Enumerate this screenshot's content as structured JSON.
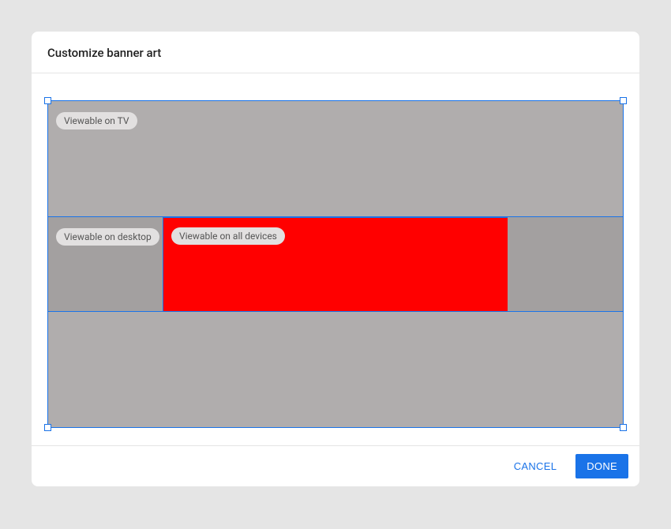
{
  "dialog": {
    "title": "Customize banner art"
  },
  "zones": {
    "tv_label": "Viewable on TV",
    "desktop_label": "Viewable on desktop",
    "safe_label": "Viewable on all devices"
  },
  "footer": {
    "cancel_label": "CANCEL",
    "done_label": "DONE"
  },
  "colors": {
    "accent": "#1a73e8",
    "safe_zone_fill": "#ff0000",
    "tv_zone_fill": "#b0adad",
    "desktop_zone_fill": "#a3a0a0"
  }
}
